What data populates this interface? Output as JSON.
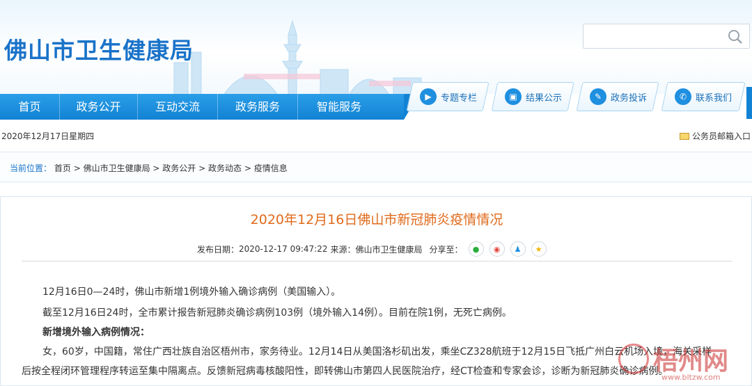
{
  "header": {
    "site_title": "佛山市卫生健康局",
    "search": {
      "placeholder": ""
    }
  },
  "nav": {
    "items": [
      {
        "label": "首页"
      },
      {
        "label": "政务公开"
      },
      {
        "label": "互动交流"
      },
      {
        "label": "政务服务"
      },
      {
        "label": "智能服务"
      }
    ],
    "quick_links": [
      {
        "label": "专题专栏",
        "icon": "play-circle-icon"
      },
      {
        "label": "结果公示",
        "icon": "monitor-icon"
      },
      {
        "label": "政务投诉",
        "icon": "pen-icon"
      },
      {
        "label": "联系我们",
        "icon": "phone-icon"
      }
    ]
  },
  "datebar": {
    "date": "2020年12月17日星期四",
    "mailbox": "公务员邮箱入口"
  },
  "breadcrumb": {
    "label": "当前位置：",
    "items": [
      "首页",
      "佛山市卫生健康局",
      "政务公开",
      "政务动态",
      "疫情信息"
    ],
    "separator": " > "
  },
  "article": {
    "title": "2020年12月16日佛山市新冠肺炎疫情情况",
    "publish_label": "发布日期：",
    "publish_date": "2020-12-17 09:47:22",
    "source_label": "来源：",
    "source": "佛山市卫生健康局",
    "share_label": "分享至：",
    "share_icons": [
      "wechat-icon",
      "weibo-icon",
      "qq-icon",
      "qzone-icon"
    ],
    "paragraphs": [
      "12月16日0—24时，佛山市新增1例境外输入确诊病例（美国输入）。",
      "截至12月16日24时，全市累计报告新冠肺炎确诊病例103例（境外输入14例）。目前在院1例，无死亡病例。",
      "新增境外输入病例情况：",
      "女，60岁，中国籍，常住广西壮族自治区梧州市，家务待业。12月14日从美国洛杉矶出发，乘坐CZ328航班于12月15日飞抵广州白云机场入境，海关采样",
      "后按全程闭环管理程序转运至集中隔离点。反馈新冠病毒核酸阳性，即转佛山市第四人民医院治疗，经CT检查和专家会诊，诊断为新冠肺炎确诊病例。"
    ]
  },
  "watermark": {
    "text": "梧州网",
    "url": "www.bltzw.com"
  },
  "colors": {
    "brand_blue": "#1a73c9",
    "nav_blue": "#1282d4",
    "title_orange": "#e06a1a"
  }
}
